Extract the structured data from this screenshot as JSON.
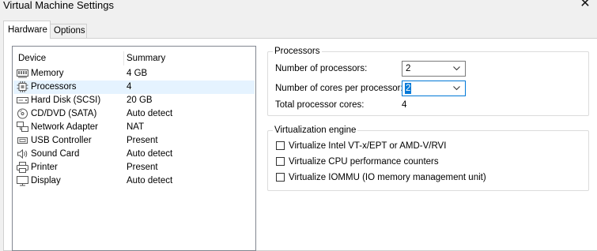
{
  "window": {
    "title": "Virtual Machine Settings"
  },
  "tabs": [
    {
      "label": "Hardware"
    },
    {
      "label": "Options"
    }
  ],
  "device_list": {
    "headers": {
      "device": "Device",
      "summary": "Summary"
    },
    "rows": [
      {
        "icon": "memory-icon",
        "name": "Memory",
        "summary": "4 GB"
      },
      {
        "icon": "processor-icon",
        "name": "Processors",
        "summary": "4",
        "selected": true
      },
      {
        "icon": "hard-disk-icon",
        "name": "Hard Disk (SCSI)",
        "summary": "20 GB"
      },
      {
        "icon": "cd-dvd-icon",
        "name": "CD/DVD (SATA)",
        "summary": "Auto detect"
      },
      {
        "icon": "network-adapter-icon",
        "name": "Network Adapter",
        "summary": "NAT"
      },
      {
        "icon": "usb-icon",
        "name": "USB Controller",
        "summary": "Present"
      },
      {
        "icon": "sound-card-icon",
        "name": "Sound Card",
        "summary": "Auto detect"
      },
      {
        "icon": "printer-icon",
        "name": "Printer",
        "summary": "Present"
      },
      {
        "icon": "display-icon",
        "name": "Display",
        "summary": "Auto detect"
      }
    ]
  },
  "processors": {
    "legend": "Processors",
    "num_processors_label": "Number of processors:",
    "num_processors_value": "2",
    "cores_label": "Number of cores per processor:",
    "cores_value": "2",
    "total_label": "Total processor cores:",
    "total_value": "4"
  },
  "virtualization": {
    "legend": "Virtualization engine",
    "options": [
      {
        "label": "Virtualize Intel VT-x/EPT or AMD-V/RVI",
        "checked": false
      },
      {
        "label": "Virtualize CPU performance counters",
        "checked": false
      },
      {
        "label": "Virtualize IOMMU (IO memory management unit)",
        "checked": false
      }
    ]
  },
  "colors": {
    "selection": "#e5f3ff",
    "focus": "#0078d7",
    "background": "#f0f0f0"
  }
}
